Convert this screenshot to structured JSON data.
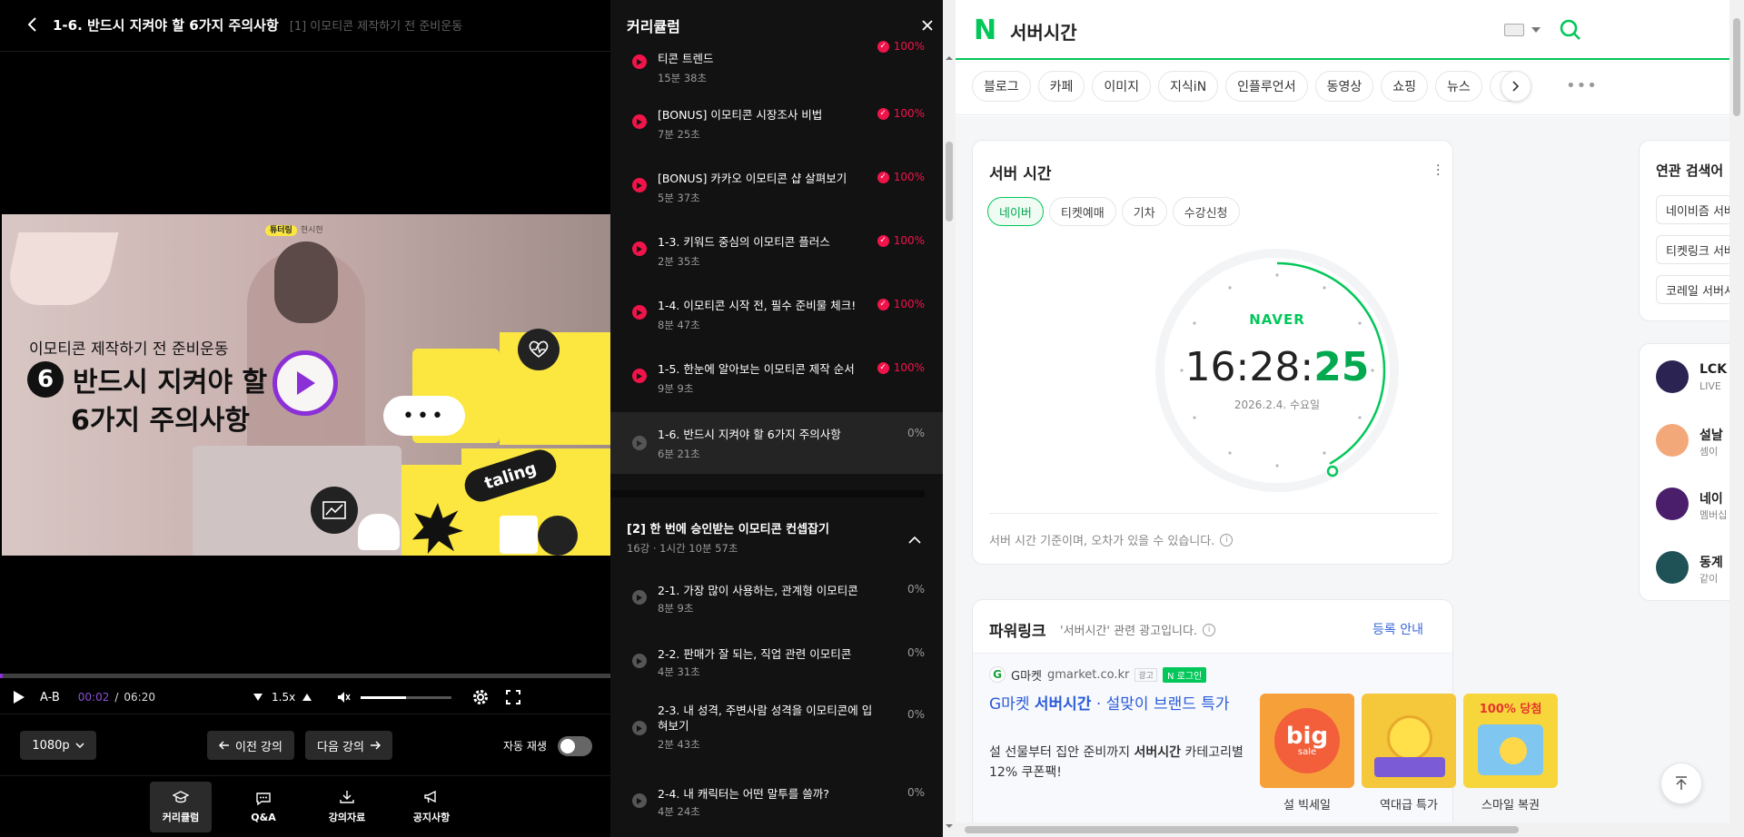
{
  "player": {
    "title": "1-6. 반드시 지켜야 할 6가지 주의사항",
    "subtitle": "[1] 이모티콘 제작하기 전 준비운동",
    "video": {
      "badge_brand": "튜터링",
      "badge_text": "현시현",
      "kicker": "이모티콘 제작하기 전 준비운동",
      "number": "6",
      "line1": "반드시 지켜야 할",
      "line2": "6가지 주의사항",
      "bubble": "•••",
      "logo": "taling"
    },
    "progress_fraction": 0.005,
    "controls": {
      "ab": "A-B",
      "current_time": "00:02",
      "separator": "/",
      "duration": "06:20",
      "speed": "1.5x",
      "volume_fraction": 0.5
    },
    "quality": "1080p",
    "prev_label": "이전 강의",
    "next_label": "다음 강의",
    "autoplay_label": "자동 재생",
    "bottom_nav": [
      "커리큘럼",
      "Q&A",
      "강의자료",
      "공지사항"
    ]
  },
  "curriculum": {
    "title": "커리큘럼",
    "lessons": [
      {
        "title": "티콘 트렌드",
        "duration": "15분 38초",
        "status": "100%",
        "done": true
      },
      {
        "title": "[BONUS] 이모티콘 시장조사 비법",
        "duration": "7분 25초",
        "status": "100%",
        "done": true
      },
      {
        "title": "[BONUS] 카카오 이모티콘 샵 살펴보기",
        "duration": "5분 37초",
        "status": "100%",
        "done": true
      },
      {
        "title": "1-3. 키워드 중심의 이모티콘 플러스",
        "duration": "2분 35초",
        "status": "100%",
        "done": true
      },
      {
        "title": "1-4. 이모티콘 시작 전, 필수 준비물 체크!",
        "duration": "8분 47초",
        "status": "100%",
        "done": true
      },
      {
        "title": "1-5. 한눈에 알아보는 이모티콘 제작 순서",
        "duration": "9분 9초",
        "status": "100%",
        "done": true
      },
      {
        "title": "1-6. 반드시 지켜야 할 6가지 주의사항",
        "duration": "6분 21초",
        "status": "0%",
        "done": false
      }
    ],
    "section2": {
      "title": "[2] 한 번에 승인받는 이모티콘 컨셉잡기",
      "meta": "16강 · 1시간 10분 57초",
      "lessons": [
        {
          "title": "2-1. 가장 많이 사용하는, 관계형 이모티콘",
          "duration": "8분 9초",
          "status": "0%"
        },
        {
          "title": "2-2. 판매가 잘 되는, 직업 관련 이모티콘",
          "duration": "4분 31초",
          "status": "0%"
        },
        {
          "title": "2-3. 내 성격, 주변사람 성격을 이모티콘에 입혀보기",
          "duration": "2분 43초",
          "status": "0%"
        },
        {
          "title": "2-4. 내 캐릭터는 어떤 말투를 쓸까?",
          "duration": "4분 24초",
          "status": "0%"
        }
      ]
    }
  },
  "naver": {
    "query": "서버시간",
    "tabs": [
      "블로그",
      "카페",
      "이미지",
      "지식iN",
      "인플루언서",
      "동영상",
      "쇼핑",
      "뉴스",
      "쇼"
    ],
    "server_card": {
      "title": "서버 시간",
      "tabs": [
        "네이버",
        "티켓예매",
        "기차",
        "수강신청"
      ],
      "brand": "NAVER",
      "time_hm": "16:28:",
      "time_s": "25",
      "date": "2026.2.4. 수요일",
      "note": "서버 시간 기준이며, 오차가 있을 수 있습니다."
    },
    "powerlink": {
      "title": "파워링크",
      "sub": "'서버시간' 관련 광고입니다.",
      "register": "등록 안내",
      "site_name": "G마켓",
      "site_url": "gmarket.co.kr",
      "ad_label": "광고",
      "login_label": "N 로그인",
      "head_a": "G마켓 ",
      "head_b": "서버시간",
      "head_c": " · 설맞이 브랜드 특가",
      "desc_a": "설 선물부터 집안 준비까지 ",
      "desc_b": "서버시간",
      "desc_c": " 카테고리별 12% 쿠폰팩!",
      "thumbs": [
        {
          "caption": "설 빅세일",
          "label": "big",
          "small": "sale",
          "color": "#f6a03a"
        },
        {
          "caption": "역대급 특가",
          "label": "",
          "small": "",
          "color": "#f4c83a"
        },
        {
          "caption": "스마일 복권",
          "label": "100% 당첨",
          "small": "",
          "color": "#f7d63c"
        }
      ]
    },
    "related": {
      "title": "연관 검색어",
      "items": [
        "네이비즘 서버시간",
        "티켓링크 서버시간",
        "코레일 서버시간"
      ]
    },
    "streams": [
      {
        "name": "LCK",
        "sub": "LIVE",
        "color": "#2b2352"
      },
      {
        "name": "설날",
        "sub": "셈이",
        "color": "#f3a87a"
      },
      {
        "name": "네이",
        "sub": "멤버십",
        "color": "#4b1e6c"
      },
      {
        "name": "동계",
        "sub": "같이",
        "color": "#1e5257"
      }
    ]
  }
}
